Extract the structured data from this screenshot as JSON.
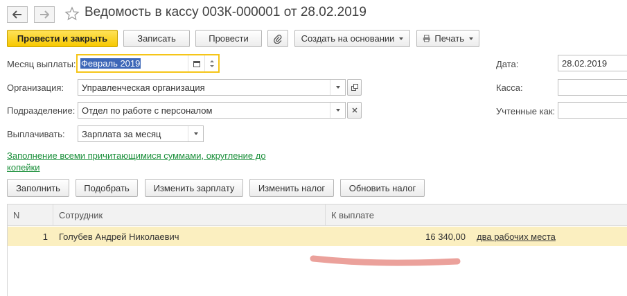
{
  "header": {
    "title": "Ведомость в кассу 003К-000001 от 28.02.2019"
  },
  "toolbar": {
    "post_close": "Провести и закрыть",
    "save": "Записать",
    "post": "Провести",
    "create_based": "Создать на основании",
    "print": "Печать"
  },
  "form": {
    "month_label": "Месяц выплаты:",
    "month_value": "Февраль 2019",
    "org_label": "Организация:",
    "org_value": "Управленческая организация",
    "dept_label": "Подразделение:",
    "dept_value": "Отдел по работе с персоналом",
    "pay_label": "Выплачивать:",
    "pay_value": "Зарплата за месяц",
    "date_label": "Дата:",
    "date_value": "28.02.2019",
    "kassa_label": "Касса:",
    "kassa_value": "",
    "counted_label": "Учтенные как:",
    "counted_value": ""
  },
  "fill_link": {
    "line1": "Заполнение всеми причитающимися суммами, округление до",
    "line2": "копейки"
  },
  "actions": {
    "fill": "Заполнить",
    "pick": "Подобрать",
    "change_salary": "Изменить зарплату",
    "change_tax": "Изменить налог",
    "update_tax": "Обновить налог"
  },
  "table": {
    "columns": [
      "N",
      "Сотрудник",
      "К выплате"
    ],
    "rows": [
      {
        "n": "1",
        "employee": "Голубев Андрей Николаевич",
        "amount": "16 340,00",
        "note": "два рабочих места"
      }
    ]
  },
  "colors": {
    "primary_button": "#f7c800",
    "selected_row": "#fbefc0",
    "link": "#1a8f3a",
    "annotation_stroke": "#eba19b"
  },
  "icons": {
    "back": "arrow-left-icon",
    "forward": "arrow-right-icon",
    "favorite": "star-icon",
    "attach": "paperclip-icon",
    "print": "printer-icon",
    "calendar": "calendar-icon",
    "open": "open-icon",
    "clear": "clear-icon"
  }
}
